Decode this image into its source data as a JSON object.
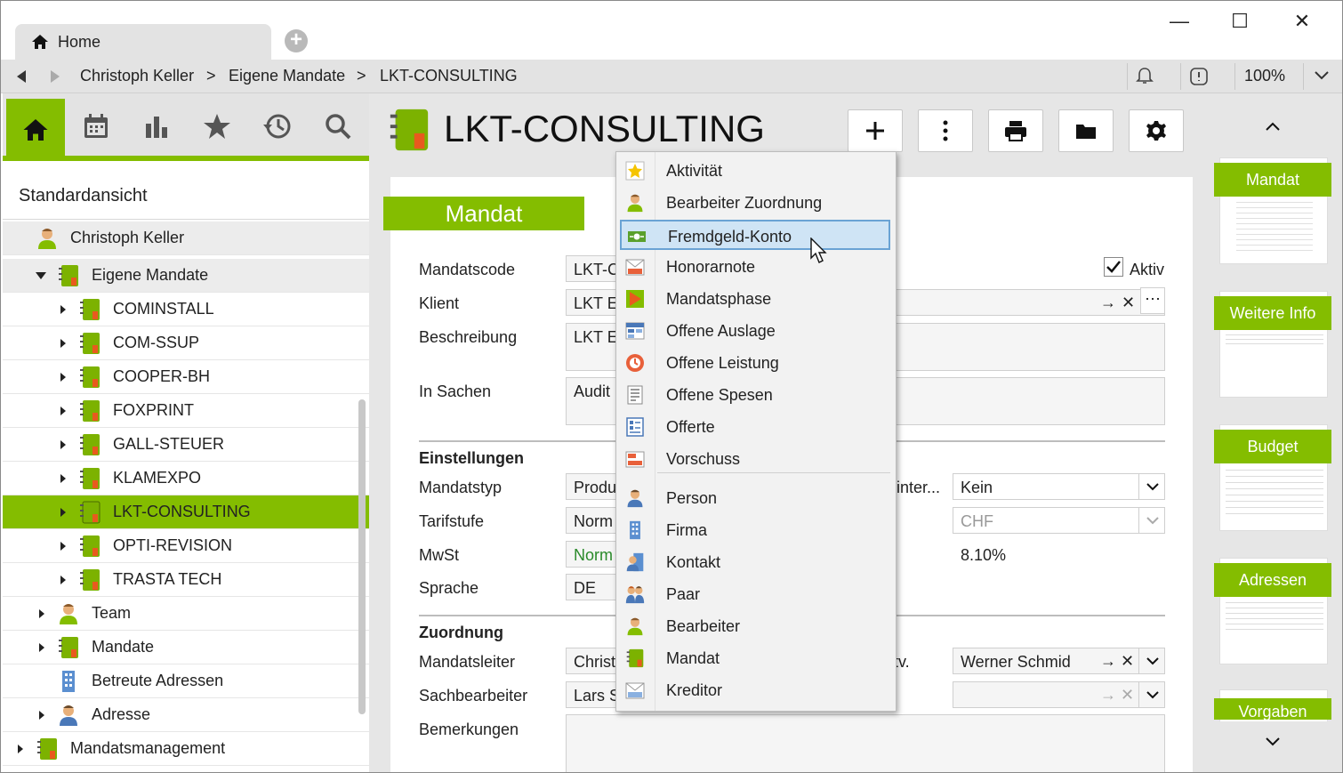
{
  "window": {
    "tab_title": "Home",
    "minimize": "—",
    "maximize": "☐",
    "close": "✕"
  },
  "nav": {
    "breadcrumb": [
      "Christoph Keller",
      "Eigene Mandate",
      "LKT-CONSULTING"
    ],
    "separator": ">",
    "zoom": "100%"
  },
  "sidebar": {
    "view_title": "Standardansicht",
    "tree": [
      {
        "label": "Christoph Keller",
        "icon": "person-icon",
        "level": 0
      },
      {
        "label": "Eigene Mandate",
        "icon": "mandate-icon",
        "level": 1,
        "expanded": true
      },
      {
        "label": "COMINSTALL",
        "icon": "mandate-icon",
        "level": 2
      },
      {
        "label": "COM-SSUP",
        "icon": "mandate-icon",
        "level": 2
      },
      {
        "label": "COOPER-BH",
        "icon": "mandate-icon",
        "level": 2
      },
      {
        "label": "FOXPRINT",
        "icon": "mandate-icon",
        "level": 2
      },
      {
        "label": "GALL-STEUER",
        "icon": "mandate-icon",
        "level": 2
      },
      {
        "label": "KLAMEXPO",
        "icon": "mandate-icon",
        "level": 2
      },
      {
        "label": "LKT-CONSULTING",
        "icon": "mandate-icon",
        "level": 2,
        "selected": true
      },
      {
        "label": "OPTI-REVISION",
        "icon": "mandate-icon",
        "level": 2
      },
      {
        "label": "TRASTA TECH",
        "icon": "mandate-icon",
        "level": 2
      },
      {
        "label": "Team",
        "icon": "person-icon",
        "level": 1
      },
      {
        "label": "Mandate",
        "icon": "mandate-icon",
        "level": 1
      },
      {
        "label": "Betreute Adressen",
        "icon": "building-icon",
        "level": 1
      },
      {
        "label": "Adresse",
        "icon": "person-blue-icon",
        "level": 1
      },
      {
        "label": "Mandatsmanagement",
        "icon": "mandate-icon",
        "level": 0
      }
    ]
  },
  "header": {
    "title": "LKT-CONSULTING"
  },
  "form": {
    "section": "Mandat",
    "labels": {
      "mandatscode": "Mandatscode",
      "klient": "Klient",
      "beschreibung": "Beschreibung",
      "in_sachen": "In Sachen",
      "einstellungen": "Einstellungen",
      "mandatstyp": "Mandatstyp",
      "tarifstufe": "Tarifstufe",
      "mwst": "MwSt",
      "sprache": "Sprache",
      "zuordnung": "Zuordnung",
      "mandatsleiter": "Mandatsleiter",
      "sachbearbeiter": "Sachbearbeiter",
      "bemerkungen": "Bemerkungen",
      "aktiv": "Aktiv",
      "partial_inter": "sinter...",
      "partial_tv": "tv."
    },
    "values": {
      "mandatscode": "LKT-C",
      "klient": "LKT Er",
      "beschreibung": "LKT Er",
      "in_sachen": "Audit",
      "mandatstyp": "Produ",
      "tarifstufe": "Norm",
      "mwst": "Norm",
      "sprache": "DE",
      "mandatsleiter": "Christ",
      "sachbearbeiter": "Lars S",
      "right_select1": "Kein",
      "right_select2": "CHF",
      "mwst_rate": "8.10%",
      "stellvertreter": "Werner Schmid"
    }
  },
  "right_panel": {
    "thumbs": [
      "Mandat",
      "Weitere Info",
      "Budget",
      "Adressen",
      "Vorgaben"
    ]
  },
  "menu": {
    "group1": [
      {
        "label": "Aktivität",
        "icon": "star-icon"
      },
      {
        "label": "Bearbeiter Zuordnung",
        "icon": "person-icon"
      },
      {
        "label": "Fremdgeld-Konto",
        "icon": "money-icon",
        "highlighted": true
      },
      {
        "label": "Honorarnote",
        "icon": "invoice-icon"
      },
      {
        "label": "Mandatsphase",
        "icon": "phase-icon"
      },
      {
        "label": "Offene Auslage",
        "icon": "expense-icon"
      },
      {
        "label": "Offene Leistung",
        "icon": "clock-icon"
      },
      {
        "label": "Offene Spesen",
        "icon": "receipt-icon"
      },
      {
        "label": "Offerte",
        "icon": "offer-icon"
      },
      {
        "label": "Vorschuss",
        "icon": "advance-icon"
      }
    ],
    "group2": [
      {
        "label": "Person",
        "icon": "person-blue-icon"
      },
      {
        "label": "Firma",
        "icon": "building-icon"
      },
      {
        "label": "Kontakt",
        "icon": "contact-icon"
      },
      {
        "label": "Paar",
        "icon": "couple-icon"
      },
      {
        "label": "Bearbeiter",
        "icon": "person-icon"
      },
      {
        "label": "Mandat",
        "icon": "mandate-icon"
      },
      {
        "label": "Kreditor",
        "icon": "creditor-icon"
      }
    ]
  },
  "colors": {
    "accent": "#84bd00",
    "highlight": "#cfe4f5"
  }
}
